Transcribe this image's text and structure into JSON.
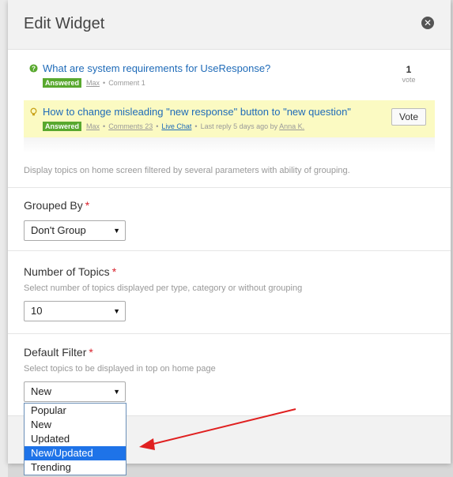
{
  "dialog": {
    "title": "Edit Widget",
    "close_icon": "close-circle-icon"
  },
  "preview": {
    "topics": [
      {
        "icon": "question-circle-icon",
        "title": "What are system requirements for UseResponse?",
        "status": "Answered",
        "author": "Max",
        "comments": "Comment 1",
        "votes": "1",
        "votes_label": "vote"
      },
      {
        "icon": "lightbulb-icon",
        "title": "How to change misleading \"new response\" button to \"new question\"",
        "status": "Answered",
        "author": "Max",
        "comments": "Comments 23",
        "category": "Live Chat",
        "last_reply": "Last reply 5 days ago by",
        "last_reply_author": "Anna K.",
        "vote_button": "Vote"
      }
    ]
  },
  "description": "Display topics on home screen filtered by several parameters with ability of grouping.",
  "fields": {
    "grouped_by": {
      "label": "Grouped By",
      "required_mark": "*",
      "value": "Don't Group"
    },
    "number_of_topics": {
      "label": "Number of Topics",
      "required_mark": "*",
      "help": "Select number of topics displayed per type, category or without grouping",
      "value": "10"
    },
    "default_filter": {
      "label": "Default Filter",
      "required_mark": "*",
      "help": "Select topics to be displayed in top on home page",
      "value": "New",
      "options": [
        "Popular",
        "New",
        "Updated",
        "New/Updated",
        "Trending"
      ],
      "highlighted_option": "New/Updated"
    }
  },
  "colors": {
    "link": "#1f6bb8",
    "answered_badge": "#58a82e",
    "highlight_row": "#fbfac2",
    "required": "#d9232d",
    "dropdown_selected": "#1e73e8",
    "annotation_arrow": "#e02020"
  }
}
